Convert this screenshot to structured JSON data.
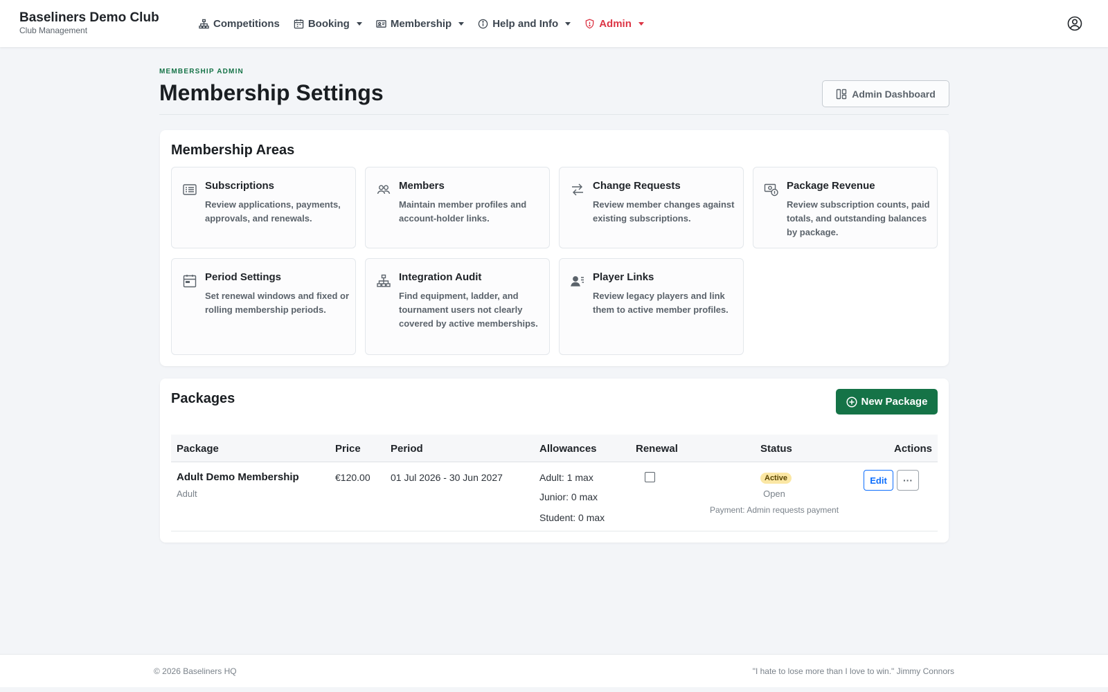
{
  "brand": {
    "name": "Baseliners Demo Club",
    "subtitle": "Club Management"
  },
  "nav": {
    "items": [
      {
        "label": "Competitions",
        "icon": "sitemap-icon",
        "dropdown": false
      },
      {
        "label": "Booking",
        "icon": "calendar-icon",
        "dropdown": true
      },
      {
        "label": "Membership",
        "icon": "id-card-icon",
        "dropdown": true
      },
      {
        "label": "Help and Info",
        "icon": "info-icon",
        "dropdown": true
      },
      {
        "label": "Admin",
        "icon": "shield-icon",
        "dropdown": true
      }
    ],
    "user_icon": "user-circle-icon"
  },
  "header": {
    "eyebrow": "MEMBERSHIP ADMIN",
    "title": "Membership Settings",
    "dashboard_button": "Admin Dashboard"
  },
  "areas": {
    "title": "Membership Areas",
    "items": [
      {
        "title": "Subscriptions",
        "desc": "Review applications, payments, approvals, and renewals.",
        "icon": "list-card-icon"
      },
      {
        "title": "Members",
        "desc": "Maintain member profiles and account-holder links.",
        "icon": "people-icon"
      },
      {
        "title": "Change Requests",
        "desc": "Review member changes against existing subscriptions.",
        "icon": "swap-arrows-icon"
      },
      {
        "title": "Package Revenue",
        "desc": "Review subscription counts, paid totals, and outstanding balances by package.",
        "icon": "cash-coin-icon"
      },
      {
        "title": "Period Settings",
        "desc": "Set renewal windows and fixed or rolling membership periods.",
        "icon": "calendar-range-icon"
      },
      {
        "title": "Integration Audit",
        "desc": "Find equipment, ladder, and tournament users not clearly covered by active memberships.",
        "icon": "diagram-icon"
      },
      {
        "title": "Player Links",
        "desc": "Review legacy players and link them to active member profiles.",
        "icon": "person-lines-icon"
      }
    ]
  },
  "packages": {
    "title": "Packages",
    "new_button": "New Package",
    "columns": [
      "Package",
      "Price",
      "Period",
      "Allowances",
      "Renewal",
      "Status",
      "Actions"
    ],
    "rows": [
      {
        "name": "Adult Demo Membership",
        "category": "Adult",
        "price": "€120.00",
        "period": "01 Jul 2026 - 30 Jun 2027",
        "allowances": [
          "Adult: 1 max",
          "Junior: 0 max",
          "Student: 0 max"
        ],
        "renewal": false,
        "status": "Active",
        "availability": "Open",
        "payment": "Payment: Admin requests payment",
        "edit_label": "Edit",
        "more_label": "···"
      }
    ]
  },
  "footer": {
    "copyright": "© 2026 Baseliners HQ",
    "quote": "\"I hate to lose more than I love to win.\" Jimmy Connors"
  },
  "colors": {
    "accent": "#157347",
    "admin": "#dc3545",
    "link": "#0d6efd",
    "badge": "#fbe7a4"
  }
}
